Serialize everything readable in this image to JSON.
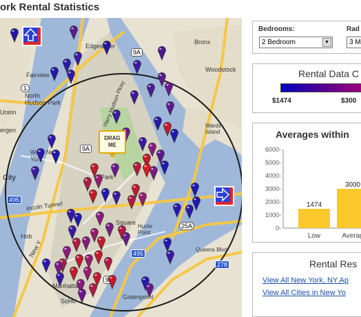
{
  "page_title": "ork Rental Statistics",
  "map": {
    "labels": {
      "edgewater": "Edgewater",
      "bronx": "Bronx",
      "fairview": "Fairview",
      "woodstock": "Woodstock",
      "north_hudson_park": "North\nHudson Park",
      "city": "City",
      "incoln_tunnel": "incoln Tunnel",
      "queens_blvd": "Queens Blvd",
      "manhattan": "Manhattan",
      "soho": "SoHo",
      "greenpoint": "Greenpoint",
      "hunters_point": "Hunte\nPoint",
      "wards_island": "Wards\nIsland",
      "harry_hudson_pkwy": "Harry Hudson Pkwy",
      "park": "Park",
      "square": "Square",
      "new_york": "New Y",
      "bergen": "ergen",
      "union": "Union",
      "hoboken": "Hob",
      "w_new_york": "West New\nYork"
    },
    "road_shields": {
      "i495_a": "495",
      "i495_b": "495",
      "i95": "9A",
      "i9a": "9A",
      "r1": "1",
      "r25a": "25A",
      "r278": "278",
      "r9a2": "9A"
    },
    "drag_marker": {
      "line1": "DRAG",
      "line2": "ME"
    },
    "nav_up_icon": "up-arrow-icon",
    "nav_right_icon": "right-arrow-icon"
  },
  "filters": {
    "bedrooms_label": "Bedrooms:",
    "bedrooms_value": "2 Bedroom",
    "radius_label": "Rad",
    "radius_value": "3 M"
  },
  "rental_color": {
    "title": "Rental Data C",
    "min_label": "$1474",
    "max_label": "$300"
  },
  "averages": {
    "title": "Averages within",
    "chart_data": {
      "type": "bar",
      "categories": [
        "Low",
        "Averag"
      ],
      "values": [
        1474,
        3000
      ],
      "data_labels": [
        "1474",
        "3000"
      ],
      "y_ticks": [
        "6000-",
        "5000-",
        "4000-",
        "3000-",
        "2000-",
        "1000-",
        "0-"
      ],
      "ylim": [
        0,
        6000
      ],
      "bar_color": "#fcc92c"
    }
  },
  "rental_links": {
    "title": "Rental Res",
    "link1": "View All New York, NY Ap",
    "link2": "View All Cities in New Yo"
  }
}
